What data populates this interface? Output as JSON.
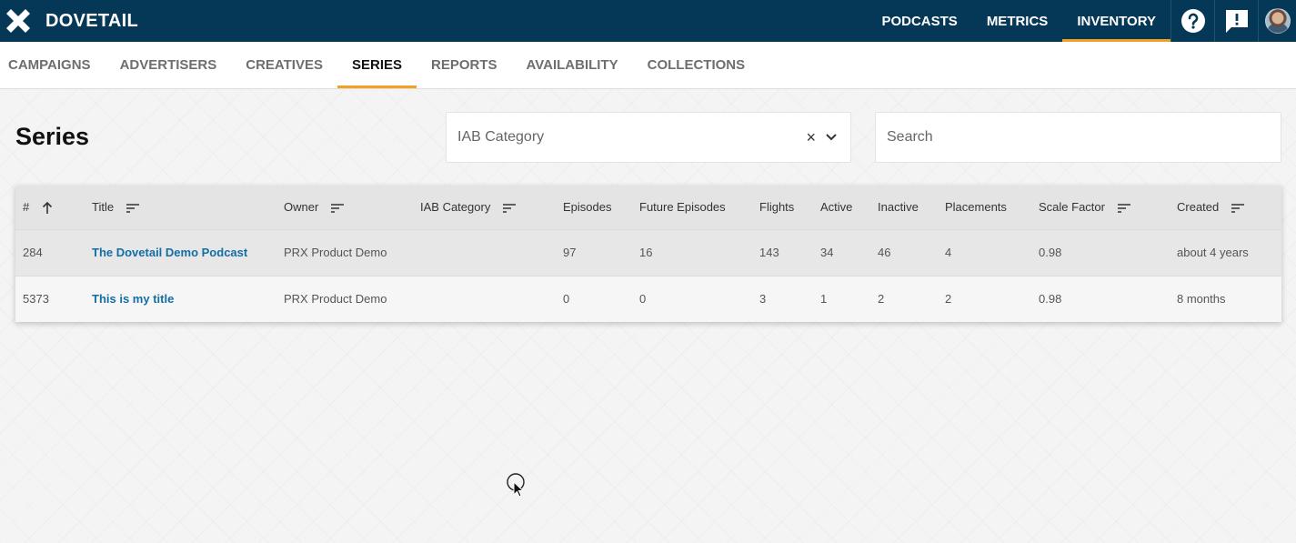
{
  "brand": {
    "name": "DOVETAIL",
    "logo_icon": "x-logo-icon"
  },
  "top_nav": {
    "items": [
      {
        "label": "PODCASTS",
        "active": false
      },
      {
        "label": "METRICS",
        "active": false
      },
      {
        "label": "INVENTORY",
        "active": true
      }
    ],
    "icons": [
      "help-icon",
      "feedback-icon",
      "avatar"
    ]
  },
  "sub_nav": {
    "items": [
      {
        "label": "CAMPAIGNS",
        "active": false
      },
      {
        "label": "ADVERTISERS",
        "active": false
      },
      {
        "label": "CREATIVES",
        "active": false
      },
      {
        "label": "SERIES",
        "active": true
      },
      {
        "label": "REPORTS",
        "active": false
      },
      {
        "label": "AVAILABILITY",
        "active": false
      },
      {
        "label": "COLLECTIONS",
        "active": false
      }
    ]
  },
  "page": {
    "title": "Series",
    "iab_filter": {
      "placeholder": "IAB Category",
      "clear": "×"
    },
    "search": {
      "placeholder": "Search"
    }
  },
  "table": {
    "columns": [
      {
        "label": "#",
        "sort": "up-arrow"
      },
      {
        "label": "Title",
        "sort": "sort"
      },
      {
        "label": "Owner",
        "sort": "sort"
      },
      {
        "label": "IAB Category",
        "sort": "sort"
      },
      {
        "label": "Episodes",
        "sort": "none"
      },
      {
        "label": "Future Episodes",
        "sort": "none"
      },
      {
        "label": "Flights",
        "sort": "none"
      },
      {
        "label": "Active",
        "sort": "none"
      },
      {
        "label": "Inactive",
        "sort": "none"
      },
      {
        "label": "Placements",
        "sort": "none"
      },
      {
        "label": "Scale Factor",
        "sort": "sort"
      },
      {
        "label": "Created",
        "sort": "sort"
      }
    ],
    "rows": [
      {
        "id": "284",
        "title": "The Dovetail Demo Podcast",
        "owner": "PRX Product Demo",
        "iab": "",
        "episodes": "97",
        "future": "16",
        "flights": "143",
        "active": "34",
        "inactive": "46",
        "placements": "4",
        "scale": "0.98",
        "created": "about 4 years"
      },
      {
        "id": "5373",
        "title": "This is my title",
        "owner": "PRX Product Demo",
        "iab": "",
        "episodes": "0",
        "future": "0",
        "flights": "3",
        "active": "1",
        "inactive": "2",
        "placements": "2",
        "scale": "0.98",
        "created": "8 months"
      }
    ]
  },
  "colors": {
    "header_bg": "#053857",
    "accent": "#f3a125",
    "link": "#136ea3"
  }
}
